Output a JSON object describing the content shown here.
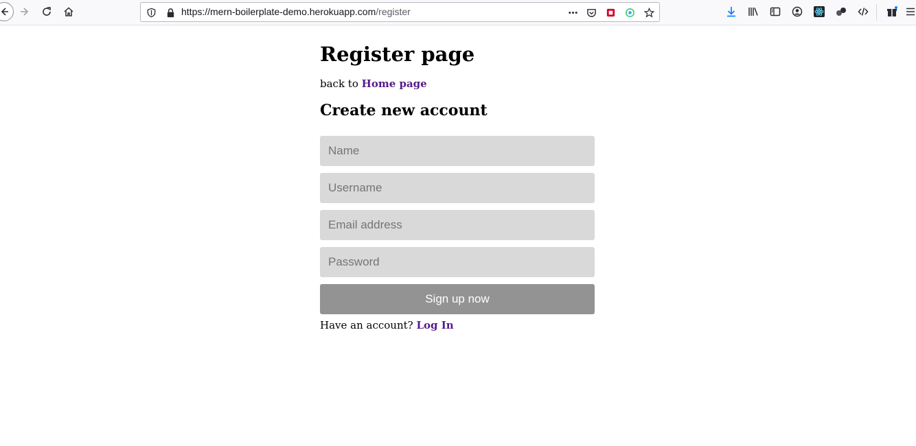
{
  "browser": {
    "url_host": "https://mern-boilerplate-demo.herokuapp.com",
    "url_path": "/register",
    "icons": [
      "back-icon",
      "forward-icon",
      "reload-icon",
      "home-icon",
      "shield-icon",
      "lock-icon",
      "more-icon",
      "pocket-icon",
      "extension-icon",
      "sync-icon",
      "bookmark-star-icon",
      "download-icon",
      "library-icon",
      "sidebar-icon",
      "account-icon",
      "react-devtools-icon",
      "extensions-icon",
      "dev-code-icon",
      "gift-icon",
      "menu-icon"
    ]
  },
  "page": {
    "title": "Register page",
    "back_prefix": "back to",
    "back_link": "Home page",
    "subtitle": "Create new account"
  },
  "form": {
    "name_placeholder": "Name",
    "username_placeholder": "Username",
    "email_placeholder": "Email address",
    "password_placeholder": "Password",
    "submit_label": "Sign up now",
    "login_prefix": "Have an account?",
    "login_link": "Log In"
  }
}
